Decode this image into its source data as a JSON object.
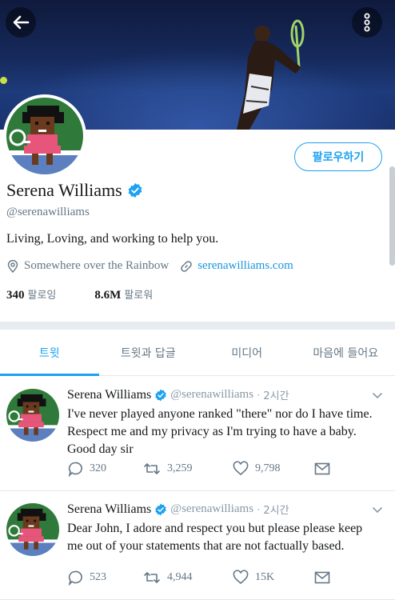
{
  "header": {
    "back_icon": "arrow-left-icon",
    "more_icon": "vertical-dots-icon"
  },
  "profile": {
    "name": "Serena Williams",
    "handle": "@serenawilliams",
    "bio": "Living, Loving, and working to help you.",
    "location": "Somewhere over the Rainbow",
    "website": "serenawilliams.com",
    "following_count": "340",
    "following_label": "팔로잉",
    "followers_count": "8.6M",
    "followers_label": "팔로워",
    "follow_button": "팔로우하기"
  },
  "tabs": [
    {
      "label": "트윗",
      "active": true
    },
    {
      "label": "트윗과 답글",
      "active": false
    },
    {
      "label": "미디어",
      "active": false
    },
    {
      "label": "마음에 들어요",
      "active": false
    }
  ],
  "tweets": [
    {
      "name": "Serena Williams",
      "handle": "@serenawilliams",
      "dot": "·",
      "time": "2시간",
      "text": "I've never played anyone ranked \"there\" nor do I have time. Respect me and my privacy as I'm trying to have a baby. Good day sir",
      "replies": "320",
      "retweets": "3,259",
      "likes": "9,798"
    },
    {
      "name": "Serena Williams",
      "handle": "@serenawilliams",
      "dot": "·",
      "time": "2시간",
      "text": "Dear John, I adore and respect you but please please keep me out of your statements that are not factually based.",
      "replies": "523",
      "retweets": "4,944",
      "likes": "15K"
    }
  ],
  "colors": {
    "accent": "#1da1f2",
    "link": "#1b95e0",
    "muted": "#657786",
    "banner": "#162a5c"
  }
}
